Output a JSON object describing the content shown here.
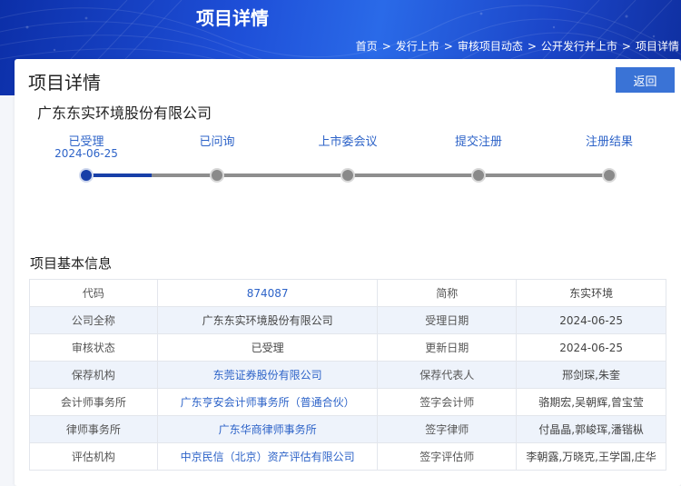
{
  "header": {
    "title": "项目详情",
    "breadcrumb": [
      {
        "label": "首页",
        "link": true
      },
      {
        "label": "发行上市",
        "link": true
      },
      {
        "label": "审核项目动态",
        "link": true
      },
      {
        "label": "公开发行并上市",
        "link": true
      },
      {
        "label": "项目详情",
        "link": false
      }
    ],
    "breadcrumb_separator": ">"
  },
  "card": {
    "title": "项目详情",
    "back_label": "返回",
    "company_name": "广东东实环境股份有限公司"
  },
  "progress": {
    "steps": [
      {
        "label": "已受理",
        "date": "2024-06-25",
        "active": true
      },
      {
        "label": "已问询",
        "date": "",
        "active": false
      },
      {
        "label": "上市委会议",
        "date": "",
        "active": false
      },
      {
        "label": "提交注册",
        "date": "",
        "active": false
      },
      {
        "label": "注册结果",
        "date": "",
        "active": false
      }
    ],
    "completed_fraction": 0.125,
    "colors": {
      "active": "#173fa8",
      "inactive": "#8e8e8e",
      "label": "#2d63c8"
    }
  },
  "basic_info": {
    "section_title": "项目基本信息",
    "rows": [
      {
        "l1": "代码",
        "v1": "874087",
        "v1_link": true,
        "l2": "简称",
        "v2": "东实环境"
      },
      {
        "l1": "公司全称",
        "v1": "广东东实环境股份有限公司",
        "v1_link": false,
        "l2": "受理日期",
        "v2": "2024-06-25"
      },
      {
        "l1": "审核状态",
        "v1": "已受理",
        "v1_link": false,
        "l2": "更新日期",
        "v2": "2024-06-25"
      },
      {
        "l1": "保荐机构",
        "v1": "东莞证券股份有限公司",
        "v1_link": true,
        "l2": "保荐代表人",
        "v2": "邢剑琛,朱奎"
      },
      {
        "l1": "会计师事务所",
        "v1": "广东亨安会计师事务所（普通合伙）",
        "v1_link": true,
        "l2": "签字会计师",
        "v2": "骆期宏,吴朝辉,曾宝莹"
      },
      {
        "l1": "律师事务所",
        "v1": "广东华商律师事务所",
        "v1_link": true,
        "l2": "签字律师",
        "v2": "付晶晶,郭峻珲,潘锴枞"
      },
      {
        "l1": "评估机构",
        "v1": "中京民信（北京）资产评估有限公司",
        "v1_link": true,
        "l2": "签字评估师",
        "v2": "李朝露,万晓克,王学国,庄华"
      }
    ]
  }
}
